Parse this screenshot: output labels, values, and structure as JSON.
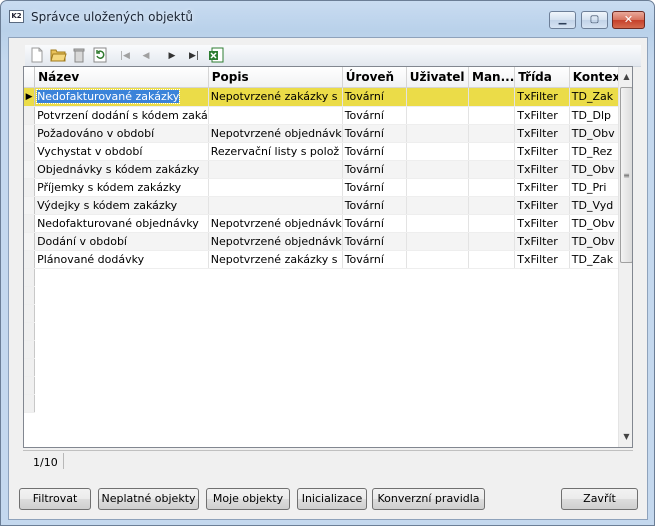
{
  "window": {
    "title": "Správce uložených objektů",
    "app_icon_label": "K2",
    "minimize": "▁",
    "maximize": "▢",
    "close": "✕"
  },
  "toolbar": {
    "icons": [
      "new-icon",
      "open-folder-icon",
      "delete-icon",
      "refresh-icon",
      "first-record-icon",
      "previous-record-icon",
      "next-record-icon",
      "last-record-icon",
      "excel-export-icon"
    ]
  },
  "grid": {
    "columns": [
      "Název",
      "Popis",
      "Úroveň",
      "Uživatel",
      "Man...",
      "Třída",
      "Kontext"
    ],
    "rows": [
      [
        "Nedofakturované zakázky",
        "Nepotvrzené zakázky s",
        "Tovární",
        "",
        "",
        "TxFilter",
        "TD_Zak"
      ],
      [
        "Potvrzení dodání s kódem zaká",
        "",
        "Tovární",
        "",
        "",
        "TxFilter",
        "TD_Dlp"
      ],
      [
        "Požadováno v období",
        "Nepotvrzené objednávk",
        "Tovární",
        "",
        "",
        "TxFilter",
        "TD_Obv"
      ],
      [
        "Vychystat v období",
        "Rezervační listy s polož",
        "Tovární",
        "",
        "",
        "TxFilter",
        "TD_Rez"
      ],
      [
        "Objednávky s kódem zakázky",
        "",
        "Tovární",
        "",
        "",
        "TxFilter",
        "TD_Obv"
      ],
      [
        "Příjemky s kódem zakázky",
        "",
        "Tovární",
        "",
        "",
        "TxFilter",
        "TD_Pri"
      ],
      [
        "Výdejky s kódem zakázky",
        "",
        "Tovární",
        "",
        "",
        "TxFilter",
        "TD_Vyd"
      ],
      [
        "Nedofakturované objednávky",
        "Nepotvrzené objednávk",
        "Tovární",
        "",
        "",
        "TxFilter",
        "TD_Obv"
      ],
      [
        "Dodání v období",
        "Nepotvrzené objednávk",
        "Tovární",
        "",
        "",
        "TxFilter",
        "TD_Obv"
      ],
      [
        "Plánované dodávky",
        "Nepotvrzené zakázky s",
        "Tovární",
        "",
        "",
        "TxFilter",
        "TD_Zak"
      ]
    ],
    "selected_row": 0,
    "selection_color": "#ebdc48",
    "row_indicator": "▶"
  },
  "status": {
    "record_position": "1/10"
  },
  "buttons": {
    "filter": "Filtrovat",
    "invalid_objects": "Neplatné objekty",
    "my_objects": "Moje objekty",
    "initialization": "Inicializace",
    "conversion_rules": "Konverzní pravidla",
    "close": "Zavřít"
  }
}
